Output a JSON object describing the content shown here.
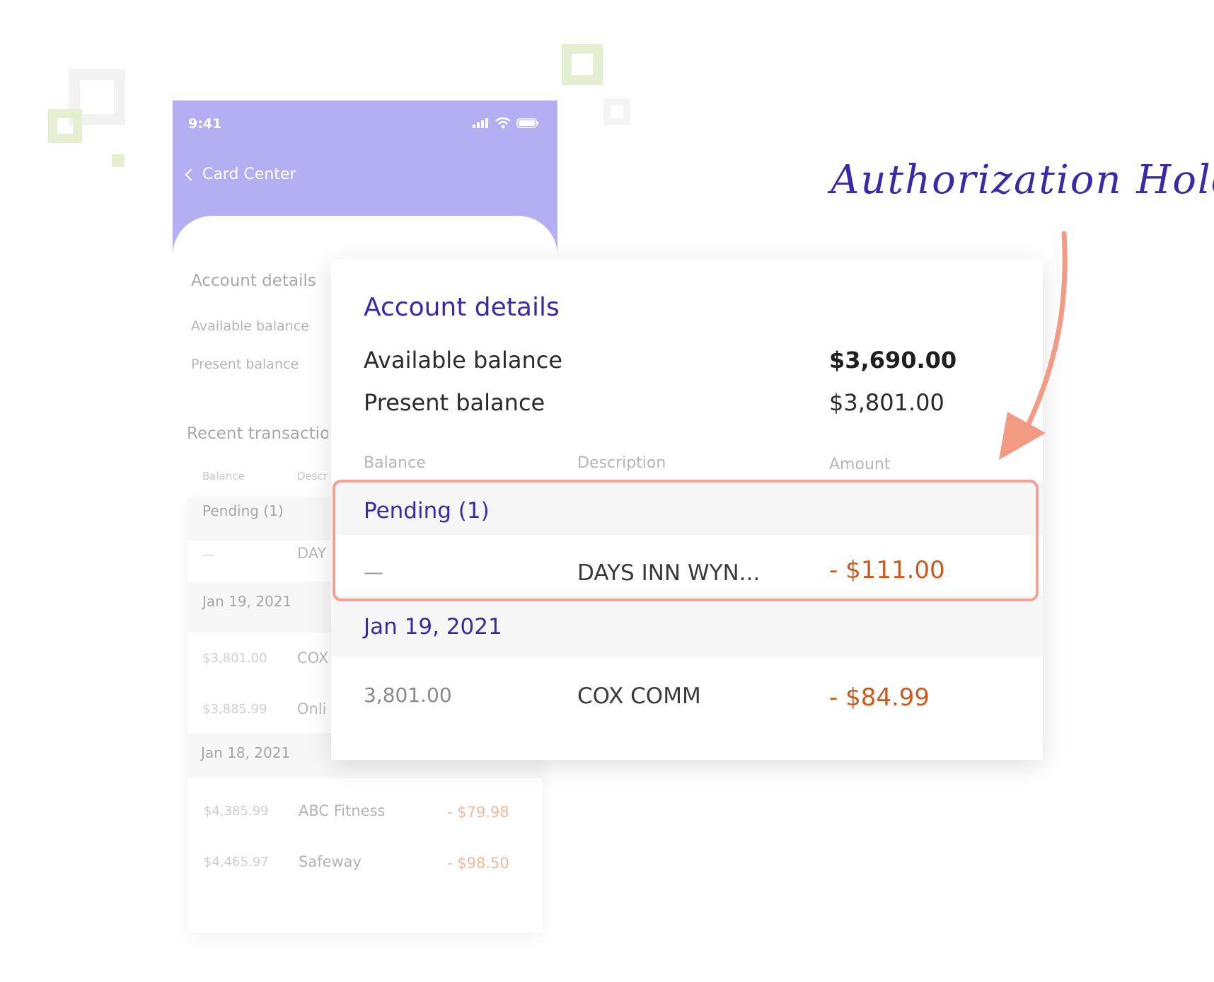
{
  "status_bar": {
    "time": "9:41"
  },
  "nav": {
    "back_label": "Card Center"
  },
  "background_screen": {
    "section_title": "Account details",
    "available_label": "Available balance",
    "present_label": "Present balance",
    "recent_title": "Recent transaction",
    "col_balance": "Balance",
    "col_description": "Descr",
    "pending_group": "Pending (1)",
    "pending_row": {
      "balance": "—",
      "description": "DAY"
    },
    "groups": [
      {
        "date": "Jan 19, 2021",
        "rows": [
          {
            "balance": "$3,801.00",
            "description": "COX"
          },
          {
            "balance": "$3,885.99",
            "description": "Onli"
          }
        ]
      },
      {
        "date": "Jan 18, 2021",
        "rows": [
          {
            "balance": "$4,385.99",
            "description": "ABC Fitness",
            "amount": "- $79.98"
          },
          {
            "balance": "$4,465.97",
            "description": "Safeway",
            "amount": "- $98.50"
          }
        ]
      }
    ]
  },
  "detail_card": {
    "title": "Account details",
    "available_label": "Available balance",
    "available_value": "$3,690.00",
    "present_label": "Present balance",
    "present_value": "$3,801.00",
    "columns": {
      "balance": "Balance",
      "description": "Description",
      "amount": "Amount"
    },
    "pending_group": "Pending (1)",
    "pending_row": {
      "balance": "—",
      "description": "DAYS INN WYN...",
      "amount": "- $111.00"
    },
    "date_group": "Jan 19, 2021",
    "date_row": {
      "balance": "3,801.00",
      "description": "COX COMM",
      "amount": "- $84.99"
    }
  },
  "annotation": {
    "text": "Authorization Hold"
  },
  "colors": {
    "header_purple": "#b4aef2",
    "accent_indigo": "#3b2aa8",
    "amount_orange": "#cc5a1e",
    "highlight_salmon": "#f2a197",
    "decor_green": "#e3efd0"
  }
}
